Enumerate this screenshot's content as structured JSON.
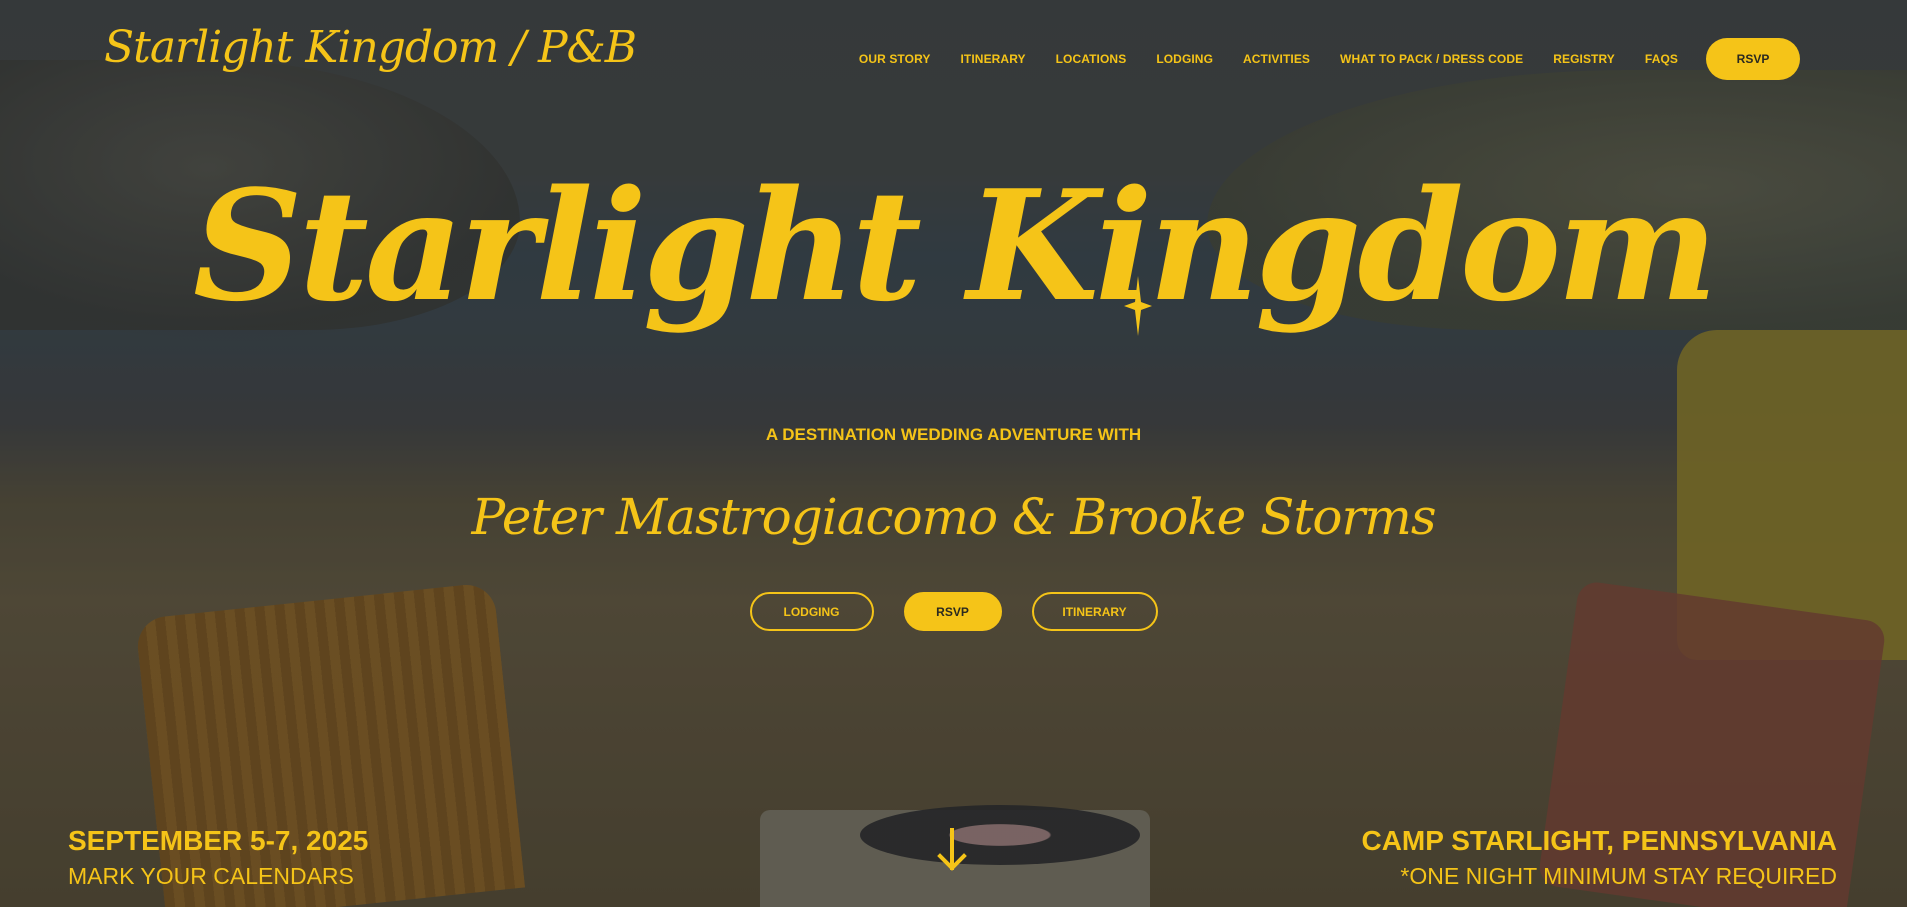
{
  "header": {
    "brand": "Starlight Kingdom / P&B",
    "nav": [
      "OUR STORY",
      "ITINERARY",
      "LOCATIONS",
      "LODGING",
      "ACTIVITIES",
      "WHAT TO PACK / DRESS CODE",
      "REGISTRY",
      "FAQS"
    ],
    "rsvp_label": "RSVP"
  },
  "hero": {
    "title": "Starlight Kingdom",
    "tagline": "A DESTINATION WEDDING ADVENTURE WITH",
    "couple": "Peter Mastrogiacomo & Brooke Storms",
    "buttons": {
      "lodging": "LODGING",
      "rsvp": "RSVP",
      "itinerary": "ITINERARY"
    }
  },
  "footer_info": {
    "date": "SEPTEMBER 5-7, 2025",
    "date_note": "MARK YOUR CALENDARS",
    "location": "CAMP STARLIGHT, PENNSYLVANIA",
    "location_note": "*ONE NIGHT MINIMUM STAY REQUIRED"
  },
  "icons": {
    "sparkle": "sparkle-icon",
    "scroll": "down-arrow-icon"
  },
  "colors": {
    "accent": "#f5c418",
    "button_text": "#2b2a20"
  }
}
